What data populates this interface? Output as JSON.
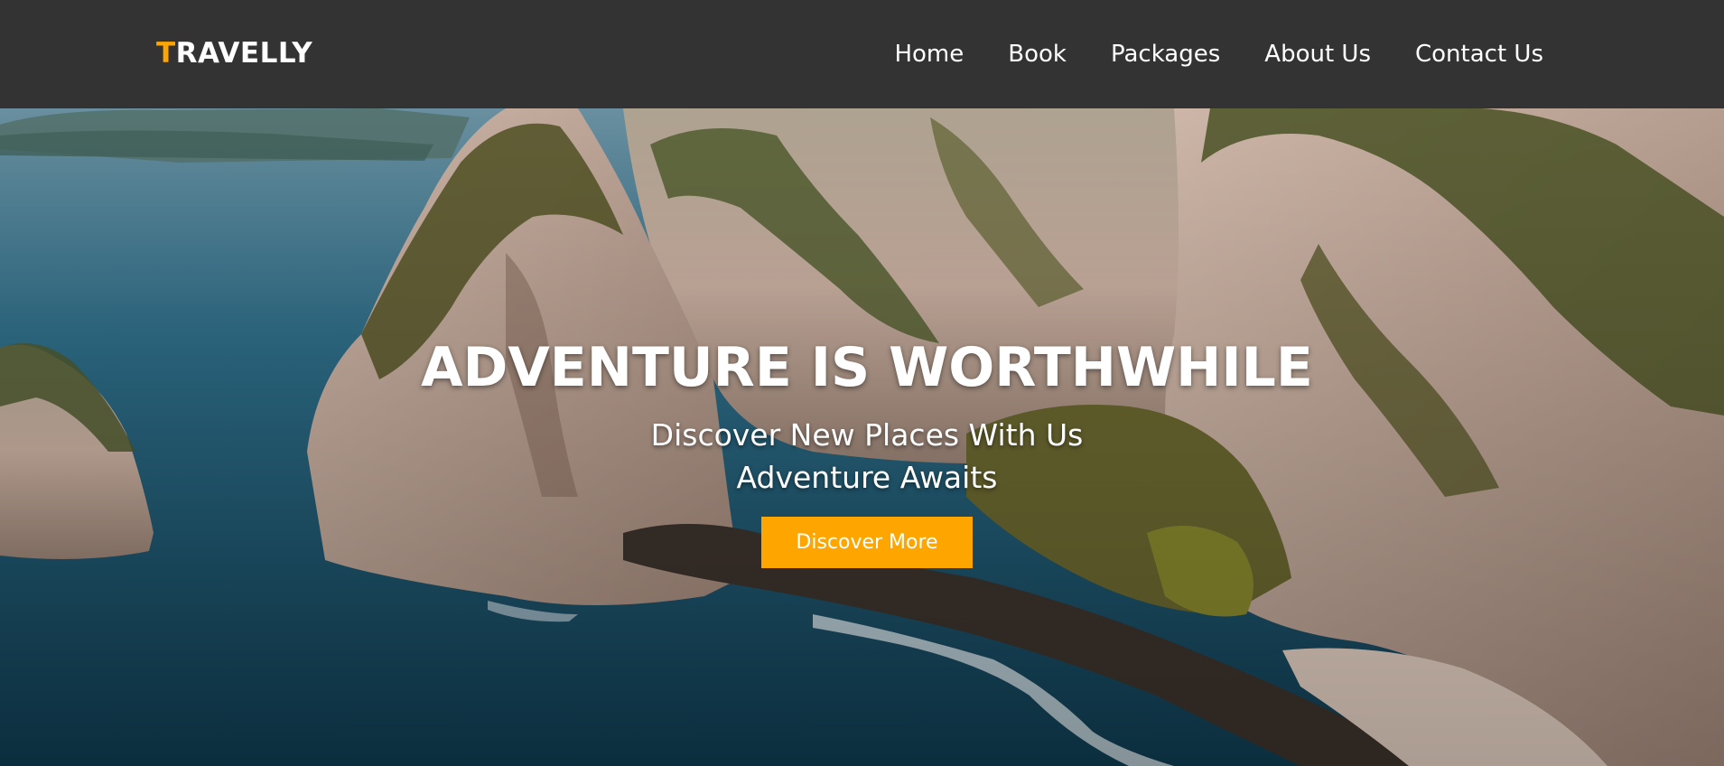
{
  "brand": {
    "logo_first_letter": "T",
    "logo_rest": "RAVELLY",
    "accent_color": "#ffa500",
    "header_bg": "#333333"
  },
  "nav": {
    "items": [
      {
        "label": "Home"
      },
      {
        "label": "Book"
      },
      {
        "label": "Packages"
      },
      {
        "label": "About Us"
      },
      {
        "label": "Contact Us"
      }
    ]
  },
  "hero": {
    "title": "ADVENTURE IS WORTHWHILE",
    "subtitle_line1": "Discover New Places With Us",
    "subtitle_line2": "Adventure Awaits",
    "cta_label": "Discover More",
    "background": "coastal-cliffs-photo"
  }
}
